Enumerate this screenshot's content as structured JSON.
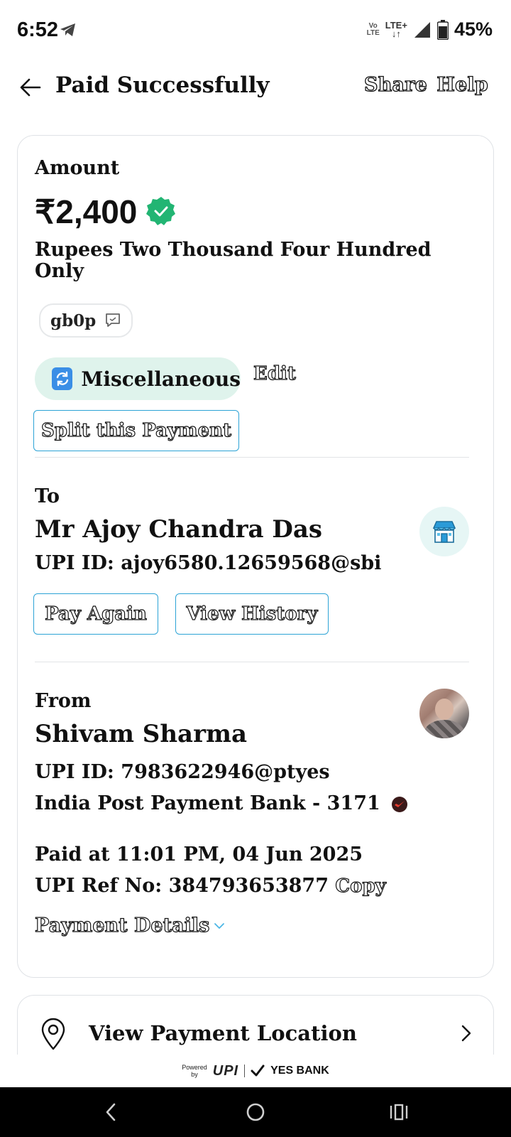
{
  "status_bar": {
    "time": "6:52",
    "volte_top": "Vo",
    "volte_bottom": "LTE",
    "network": "LTE+",
    "battery": "45%"
  },
  "header": {
    "title": "Paid Successfully",
    "share_label": "Share",
    "help_label": "Help"
  },
  "amount": {
    "label": "Amount",
    "value": "₹2,400",
    "words": "Rupees Two Thousand Four Hundred Only",
    "note": "gb0p"
  },
  "category": {
    "label": "Miscellaneous",
    "edit_label": "Edit",
    "split_label": "Split this Payment"
  },
  "to": {
    "label": "To",
    "name": "Mr Ajoy Chandra Das",
    "upi": "UPI ID: ajoy6580.12659568@sbi",
    "pay_again": "Pay Again",
    "view_history": "View History"
  },
  "from": {
    "label": "From",
    "name": "Shivam Sharma",
    "upi": "UPI ID: 7983622946@ptyes",
    "bank": "India Post Payment Bank - 3171",
    "paid_at": "Paid at 11:01 PM, 04 Jun 2025",
    "ref_no": "UPI Ref No: 384793653877",
    "copy_label": "Copy",
    "payment_details": "Payment Details"
  },
  "location": {
    "label": "View Payment Location"
  },
  "footer": {
    "powered": "Powered",
    "by": "by",
    "upi": "UPI",
    "bank": "YES BANK"
  },
  "colors": {
    "accent": "#2ca3d6",
    "success": "#22b573",
    "chip_bg": "#dff3ec"
  }
}
